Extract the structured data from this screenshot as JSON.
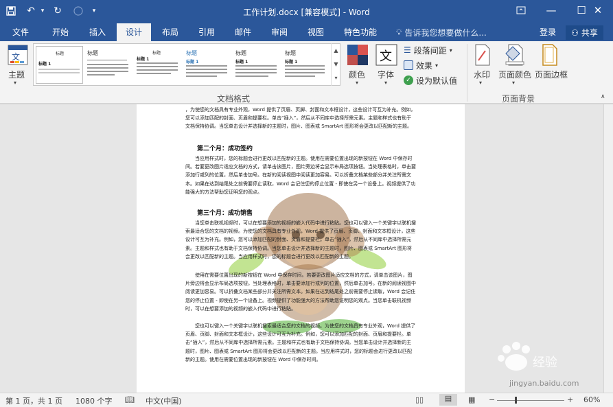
{
  "titlebar": {
    "title": "工作计划.docx [兼容模式] - Word",
    "save_icon": "save-icon",
    "undo_icon": "undo-icon",
    "redo_icon": "redo-icon"
  },
  "tabs": [
    {
      "label": "文件"
    },
    {
      "label": "开始"
    },
    {
      "label": "插入"
    },
    {
      "label": "设计"
    },
    {
      "label": "布局"
    },
    {
      "label": "引用"
    },
    {
      "label": "邮件"
    },
    {
      "label": "审阅"
    },
    {
      "label": "视图"
    },
    {
      "label": "特色功能"
    }
  ],
  "tellme": "告诉我您想要做什么...",
  "signin": "登录",
  "share": "共享",
  "ribbon": {
    "theme_label": "主题",
    "gallery_titles": [
      "标题",
      "标题",
      "标题",
      "标题",
      "标题",
      "标题"
    ],
    "gallery_headings": [
      "标题 1",
      "标题 1",
      "标题 1",
      "标题 1",
      "标题 1",
      "标题 1"
    ],
    "colors_label": "颜色",
    "fonts_label": "字体",
    "paragraph_spacing": "段落间距",
    "effects": "效果",
    "set_default": "设为默认值",
    "doc_format_group": "文档格式",
    "watermark_label": "水印",
    "page_color_label": "页面颜色",
    "page_border_label": "页面边框",
    "page_background_group": "页面背景"
  },
  "document": {
    "p1": "，为使您的文档具有专业外观，Word 提供了页眉、页脚、封面和文本框设计，这些设计可互为补充。例如，您可以添加匹配的封面、页眉和提要栏。单击“插入”，然后从不同库中选择所需元素。主题和样式也有助于文档保持协调。当您单击设计并选择新的主题时，图片、图表或 SmartArt 图形将会更改以匹配新的主题。",
    "h2": "第二个月：成功签约",
    "p2": "当应用样式时，您的标题会进行更改以匹配新的主题。使用在需要位置出现的新按钮在 Word 中保存时间。若要更改图片适应文档的方式，请单击该图片，图片旁边将会显示布局选项按钮。当处理表格时，单击要添加行或列的位置，然后单击加号。在新的阅读视图中阅读更加容易。可以折叠文档某些部分并关注所需文本。如果在达到结尾处之前需要停止读取，Word 会记住您的停止位置 - 即使在另一个设备上。视频提供了功能强大的方法帮助您证明您的观点。",
    "h3": "第三个月：成功销售",
    "p3": "当您单击联机视频时，可以在想要添加的视频的嵌入代码中进行粘贴。您也可以键入一个关键字以联机搜索最适合您的文档的视频。为使您的文档具有专业外观，Word 提供了页眉、页脚、封面和文本框设计，这些设计可互为补充。例如，您可以添加匹配的封面、页眉和提要栏。单击“插入”，然后从不同库中选择所需元素。主题和样式也有助于文档保持协调。当您单击设计并选择新的主题时，图片、图表或 SmartArt 图形将会更改以匹配新的主题。当应用样式时，您的标题会进行更改以匹配新的主题。",
    "p4": "使用在需要位置出现的新按钮在 Word 中保存时间。若要更改图片适应文档的方式，请单击该图片，图片旁边将会显示布局选项按钮。当处理表格时，单击要添加行或列的位置，然后单击加号。在新的阅读视图中阅读更加容易。可以折叠文档某些部分并关注所需文本。如果在达到结尾处之前需要停止读取，Word 会记住您的停止位置 - 即使在另一个设备上。视频提供了功能强大的方法帮助您证明您的观点。当您单击联机视频时，可以在想要添加的视频的嵌入代码中进行粘贴。",
    "p5": "您也可以键入一个关键字以联机搜索最适合您的文档的视频。为使您的文档具有专业外观，Word 提供了页眉、页脚、封面和文本框设计，这些设计可互为补充。例如，您可以添加匹配的封面、页眉和提要栏。单击“插入”，然后从不同库中选择所需元素。主题和样式也有助于文档保持协调。当您单击设计并选择新的主题时，图片、图表或 SmartArt 图形将会更改以匹配新的主题。当应用样式时，您的标题会进行更改以匹配新的主题。使用在需要位置出现的新按钮在 Word 中保存时间。"
  },
  "status": {
    "page": "第 1 页，共 1 页",
    "words": "1080 个字",
    "language": "中文(中国)",
    "zoom": "60%"
  },
  "watermark": "jingyan.baidu.com",
  "colors": {
    "brand": "#2b579a",
    "mascot_brown": "#9a6a3f",
    "mascot_green": "#4caf2f"
  }
}
